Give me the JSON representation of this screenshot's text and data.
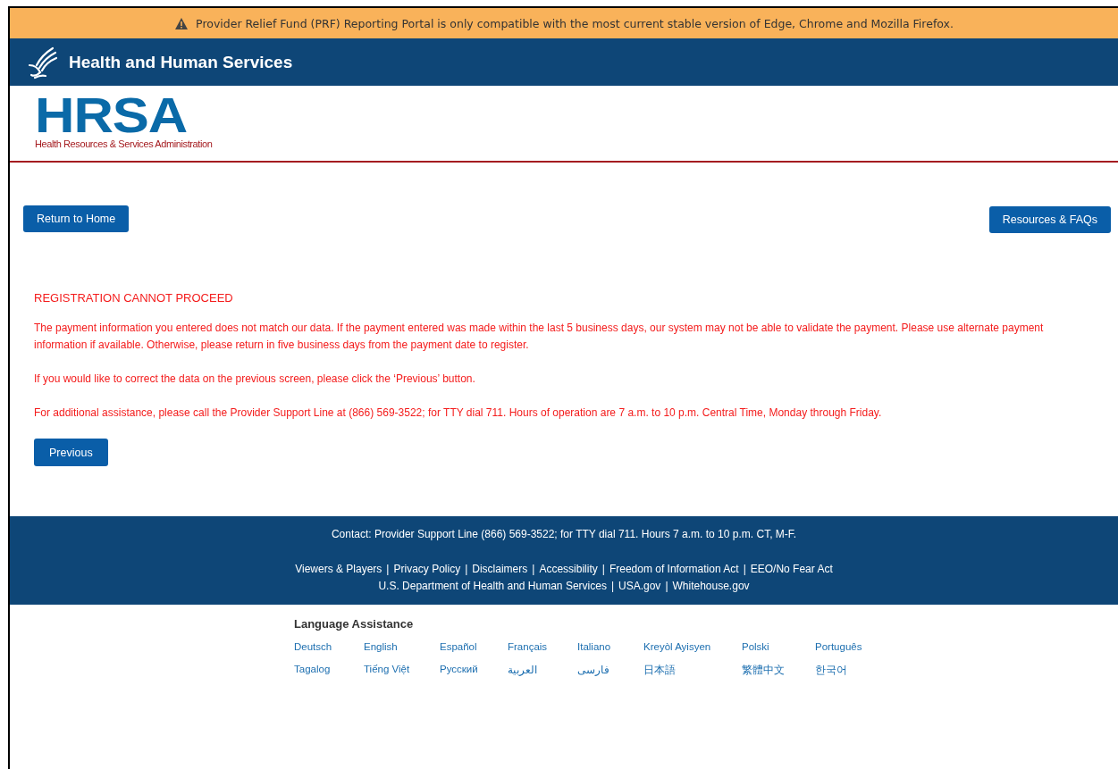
{
  "banner": {
    "text": "Provider Relief Fund (PRF) Reporting Portal is only compatible with the most current stable version of Edge, Chrome and Mozilla Firefox."
  },
  "header": {
    "title": "Health and Human Services"
  },
  "logo": {
    "name": "HRSA",
    "subtitle": "Health Resources & Services Administration"
  },
  "nav": {
    "left_button": "Return to Home",
    "right_button": "Resources & FAQs"
  },
  "message": {
    "heading": "REGISTRATION CANNOT PROCEED",
    "paragraphs": [
      "The payment information you entered does not match our data. If the payment entered was made within the last 5 business days, our system may not be able to validate the payment. Please use alternate payment information if available. Otherwise, please return in five business days from the payment date to register.",
      "If you would like to correct the data on the previous screen, please click the ‘Previous’ button.",
      "For additional assistance, please call the Provider Support Line at (866) 569-3522; for TTY dial 711. Hours of operation are 7 a.m. to 10 p.m. Central Time, Monday through Friday."
    ],
    "button": "Previous"
  },
  "footer": {
    "contact": "Contact: Provider Support Line (866) 569-3522; for TTY dial 711. Hours 7 a.m. to 10 p.m. CT, M-F.",
    "separator": "|",
    "link_rows": [
      [
        "Viewers & Players",
        "Privacy Policy",
        "Disclaimers",
        "Accessibility",
        "Freedom of Information Act",
        "EEO/No Fear Act"
      ],
      [
        "U.S. Department of Health and Human Services",
        "USA.gov",
        "Whitehouse.gov"
      ]
    ]
  },
  "language_assistance": {
    "title": "Language Assistance",
    "languages": [
      "Deutsch",
      "English",
      "Español",
      "Français",
      "Italiano",
      "Kreyòl Ayisyen",
      "Polski",
      "Português",
      "Tagalog",
      "Tiếng Việt",
      "Русский",
      "العربية",
      "فارسی",
      "日本語",
      "繁體中文",
      "한국어"
    ]
  }
}
